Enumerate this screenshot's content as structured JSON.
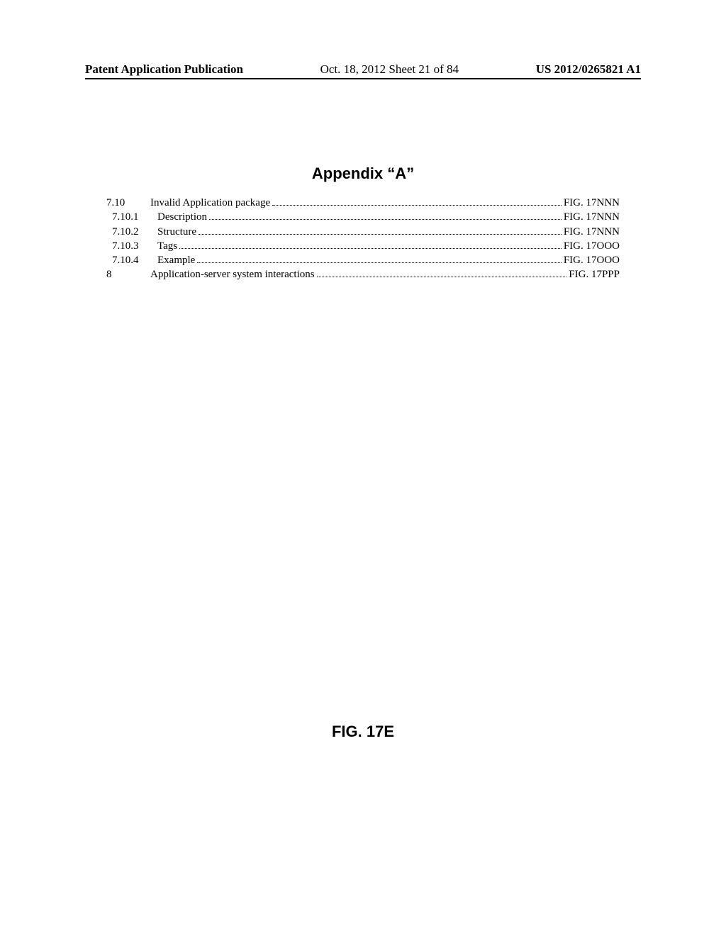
{
  "header": {
    "left": "Patent Application Publication",
    "center": "Oct. 18, 2012  Sheet 21 of 84",
    "right": "US 2012/0265821 A1"
  },
  "appendix_title": "Appendix “A”",
  "toc": [
    {
      "num": "7.10",
      "indent": false,
      "label": "Invalid Application package",
      "fig": "FIG. 17NNN"
    },
    {
      "num": "7.10.1",
      "indent": true,
      "label": "Description",
      "fig": "FIG. 17NNN"
    },
    {
      "num": "7.10.2",
      "indent": true,
      "label": "Structure",
      "fig": "FIG. 17NNN"
    },
    {
      "num": "7.10.3",
      "indent": true,
      "label": "Tags",
      "fig": "FIG. 17OOO"
    },
    {
      "num": "7.10.4",
      "indent": true,
      "label": "Example",
      "fig": "FIG. 17OOO"
    },
    {
      "num": "8",
      "indent": false,
      "label": "Application-server system interactions",
      "fig": "FIG. 17PPP"
    }
  ],
  "figure_label": "FIG. 17E"
}
